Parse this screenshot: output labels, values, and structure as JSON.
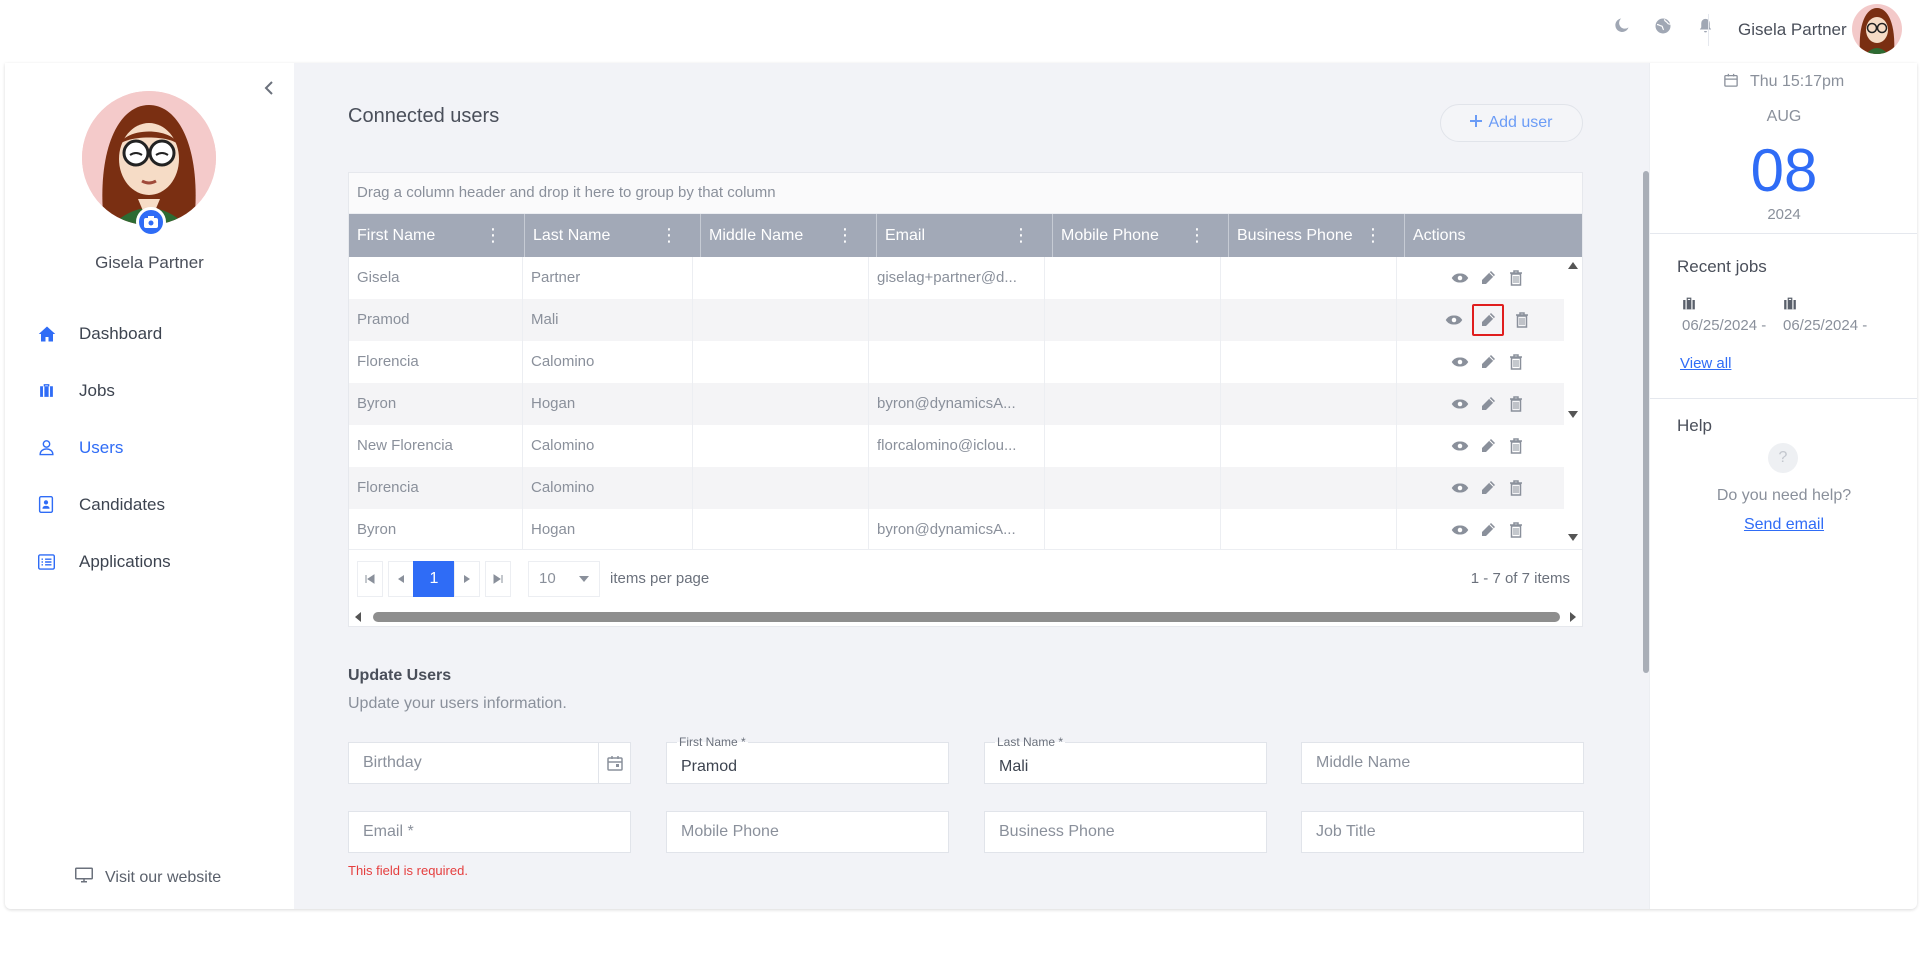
{
  "topbar": {
    "user_name": "Gisela Partner"
  },
  "sidebar": {
    "user_name": "Gisela Partner",
    "items": [
      {
        "label": "Dashboard",
        "icon": "home-icon"
      },
      {
        "label": "Jobs",
        "icon": "briefcase-icon"
      },
      {
        "label": "Users",
        "icon": "user-icon",
        "active": true
      },
      {
        "label": "Candidates",
        "icon": "id-card-icon"
      },
      {
        "label": "Applications",
        "icon": "list-icon"
      }
    ],
    "visit_label": "Visit our website"
  },
  "main": {
    "title": "Connected users",
    "add_user_label": "Add user",
    "grid": {
      "grouping_hint": "Drag a column header and drop it here to group by that column",
      "columns": [
        "First Name",
        "Last Name",
        "Middle Name",
        "Email",
        "Mobile Phone",
        "Business Phone",
        "Actions"
      ],
      "rows": [
        {
          "first": "Gisela",
          "last": "Partner",
          "middle": "",
          "email": "giselag+partner@d...",
          "mobile": "",
          "business": ""
        },
        {
          "first": "Pramod",
          "last": "Mali",
          "middle": "",
          "email": "",
          "mobile": "",
          "business": ""
        },
        {
          "first": "Florencia",
          "last": "Calomino",
          "middle": "",
          "email": "",
          "mobile": "",
          "business": ""
        },
        {
          "first": "Byron",
          "last": "Hogan",
          "middle": "",
          "email": "byron@dynamicsA...",
          "mobile": "",
          "business": ""
        },
        {
          "first": "New Florencia",
          "last": "Calomino",
          "middle": "",
          "email": "florcalomino@iclou...",
          "mobile": "",
          "business": ""
        },
        {
          "first": "Florencia",
          "last": "Calomino",
          "middle": "",
          "email": "",
          "mobile": "",
          "business": ""
        },
        {
          "first": "Byron",
          "last": "Hogan",
          "middle": "",
          "email": "byron@dynamicsA...",
          "mobile": "",
          "business": ""
        }
      ],
      "pager": {
        "current_page": "1",
        "page_size": "10",
        "items_per_page_label": "items per page",
        "info": "1 - 7 of 7 items"
      }
    },
    "update": {
      "title": "Update Users",
      "subtitle": "Update your users information.",
      "birthday_placeholder": "Birthday",
      "first_name_label": "First Name *",
      "first_name_value": "Pramod",
      "last_name_label": "Last Name *",
      "last_name_value": "Mali",
      "middle_name_placeholder": "Middle Name",
      "email_placeholder": "Email *",
      "mobile_placeholder": "Mobile Phone",
      "business_placeholder": "Business Phone",
      "job_title_placeholder": "Job Title",
      "error": "This field is required."
    }
  },
  "right": {
    "date_line": "Thu 15:17pm",
    "month": "AUG",
    "day": "08",
    "year": "2024",
    "recent_jobs_title": "Recent jobs",
    "recent_jobs": [
      "06/25/2024 -",
      "06/25/2024 -"
    ],
    "view_all": "View all",
    "help_title": "Help",
    "help_text": "Do you need help?",
    "send_email": "Send email"
  },
  "colors": {
    "accent": "#2f6cf6",
    "header_bg": "#a2a9b7",
    "error": "#e53e3e"
  }
}
